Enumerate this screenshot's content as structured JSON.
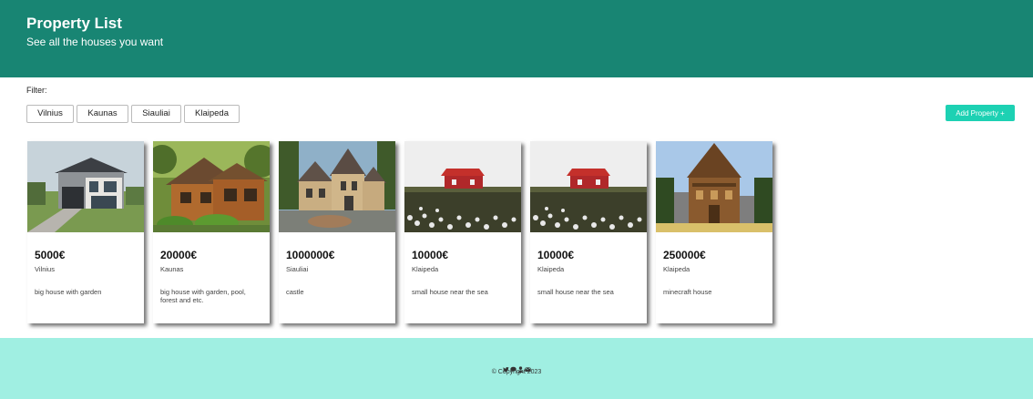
{
  "header": {
    "title": "Property List",
    "subtitle": "See all the houses you want"
  },
  "filter": {
    "label": "Filter:",
    "options": [
      "Vilnius",
      "Kaunas",
      "Siauliai",
      "Klaipeda"
    ]
  },
  "actions": {
    "add_property": "Add Property +"
  },
  "colors": {
    "header_bg": "#188573",
    "accent": "#1dd1b3",
    "footer_bg": "#a0efe2"
  },
  "properties": [
    {
      "price": "5000€",
      "city": "Vilnius",
      "description": "big house with garden",
      "image": "modern-house"
    },
    {
      "price": "20000€",
      "city": "Kaunas",
      "description": "big house with garden, pool, forest and etc.",
      "image": "log-cabin"
    },
    {
      "price": "1000000€",
      "city": "Siauliai",
      "description": "castle",
      "image": "stone-mansion"
    },
    {
      "price": "10000€",
      "city": "Klaipeda",
      "description": "small house near the sea",
      "image": "red-cottage"
    },
    {
      "price": "10000€",
      "city": "Klaipeda",
      "description": "small house near the sea",
      "image": "red-cottage"
    },
    {
      "price": "250000€",
      "city": "Klaipeda",
      "description": "minecraft house",
      "image": "minecraft-house"
    }
  ],
  "footer": {
    "icons": [
      "twitter-icon",
      "chat-icon",
      "user-icon",
      "mail-icon"
    ],
    "copyright": "© Copyright 2023"
  }
}
